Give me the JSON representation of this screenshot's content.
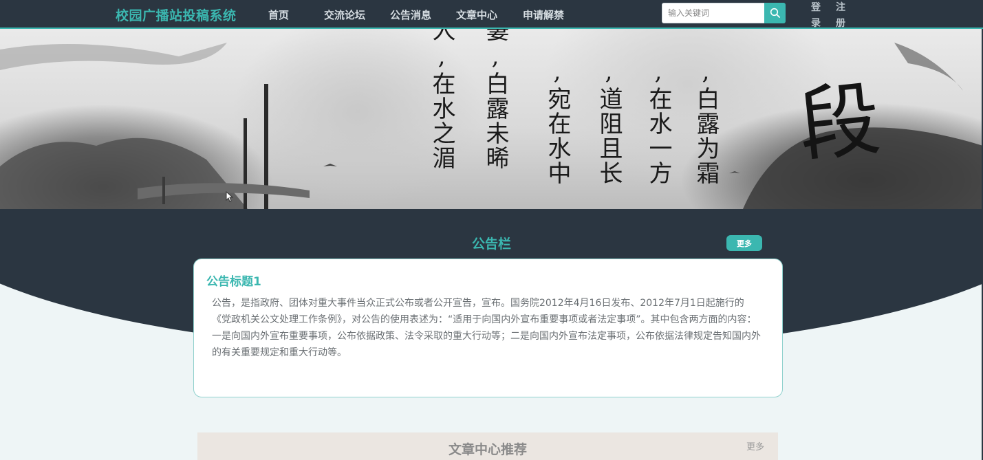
{
  "navbar": {
    "logo": "校园广播站投稿系统",
    "items": [
      "首页",
      "交流论坛",
      "公告消息",
      "文章中心",
      "申请解禁"
    ],
    "search_placeholder": "输入关键词",
    "login": [
      "登",
      "录"
    ],
    "register": [
      "注",
      "册"
    ]
  },
  "banner": {
    "poem_columns": [
      ",白露为霜",
      ",在水一方",
      ",道阻且长",
      ",宛在水中",
      ",白露未晞",
      ",在水之湄"
    ],
    "column_tops": [
      "白",
      "在",
      "道",
      "宛",
      "白",
      "在"
    ],
    "big_glyph": "段",
    "col_headers": [
      "人",
      "萋"
    ]
  },
  "notice_board": {
    "title": "公告栏",
    "more_label": "更多",
    "card": {
      "title": "公告标题1",
      "body": "公告，是指政府、团体对重大事件当众正式公布或者公开宣告，宣布。国务院2012年4月16日发布、2012年7月1日起施行的《党政机关公文处理工作条例》，对公告的使用表述为：“适用于向国内外宣布重要事项或者法定事项”。其中包含两方面的内容：一是向国内外宣布重要事项，公布依据政策、法令采取的重大行动等；二是向国内外宣布法定事项，公布依据法律规定告知国内外的有关重要规定和重大行动等。"
    }
  },
  "article_center": {
    "title": "文章中心推荐",
    "more_label": "更多"
  },
  "colors": {
    "navbar_bg": "#2b3641",
    "accent": "#3bb7b0",
    "page_bg": "#eef5f6"
  }
}
